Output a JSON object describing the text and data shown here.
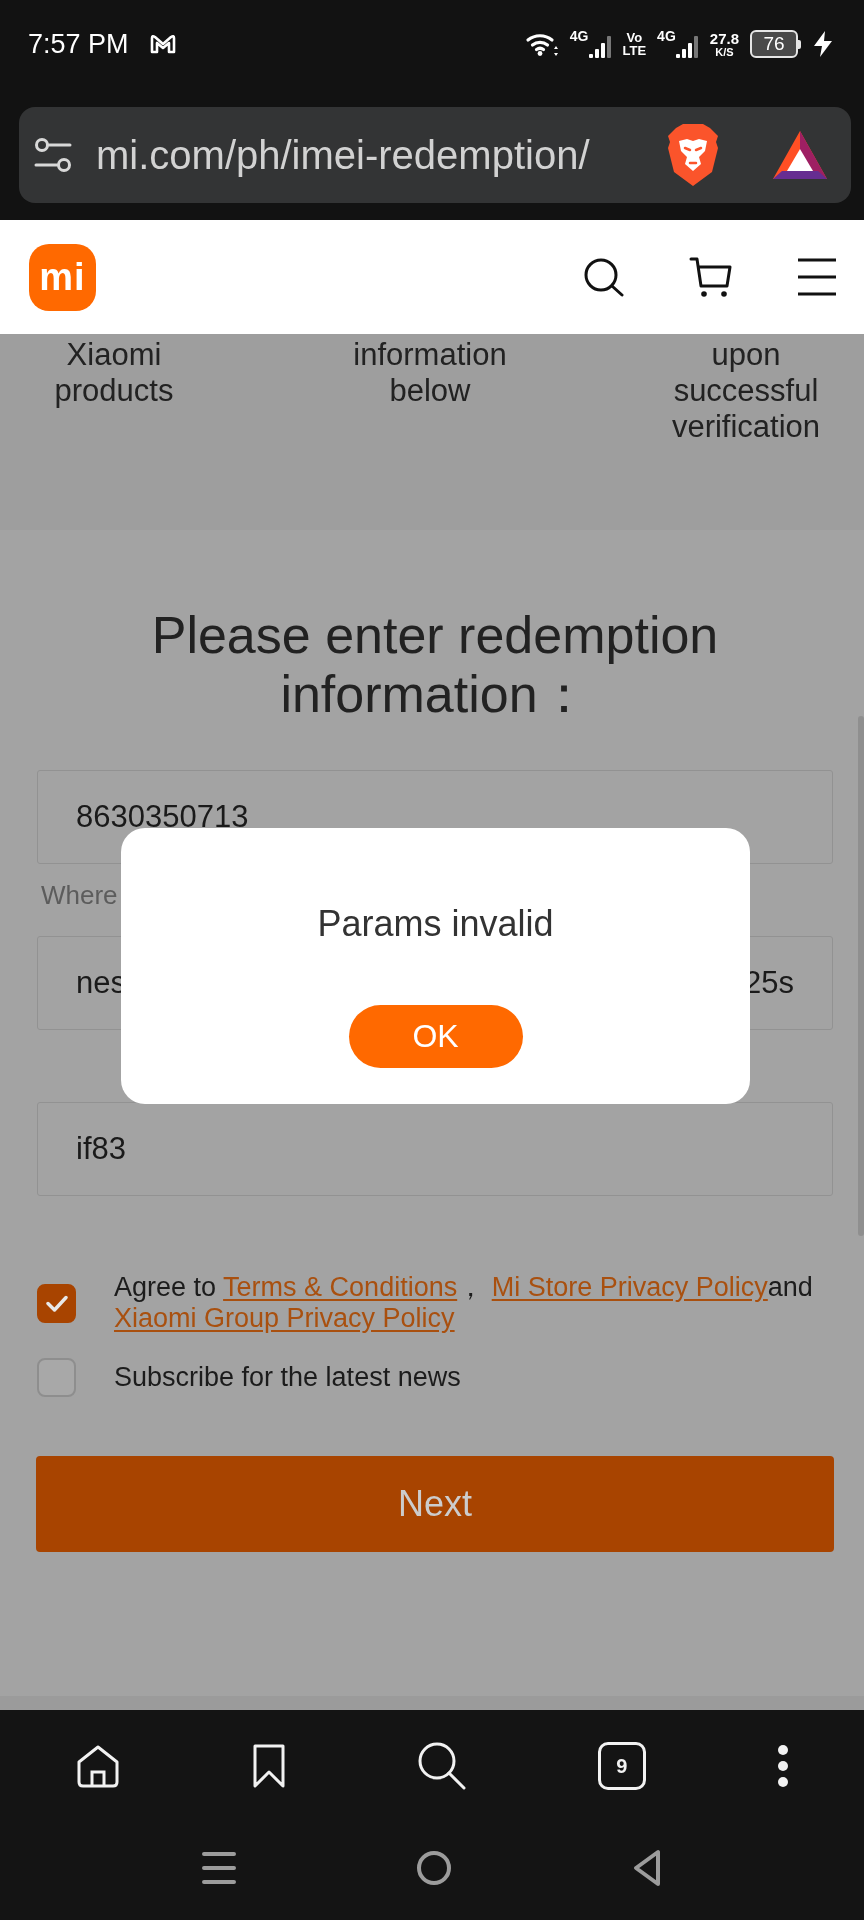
{
  "status_bar": {
    "time": "7:57 PM",
    "network_1": "4G",
    "volte": [
      "Vo",
      "LTE"
    ],
    "network_2": "4G",
    "speed": "27.8",
    "speed_unit": "K/S",
    "battery": "76"
  },
  "address_bar": {
    "url": "mi.com/ph/imei-redemption/"
  },
  "site_header": {
    "logo": "mi"
  },
  "steps": [
    "Xiaomi products",
    "information below",
    "upon successful verification"
  ],
  "form": {
    "heading": "Please enter redemption information：",
    "fields": [
      {
        "kind": "text",
        "value": "8630350713",
        "help": "Where"
      },
      {
        "kind": "split",
        "value_start": "nes",
        "value_end": "25s"
      },
      {
        "kind": "text",
        "value": "if83"
      }
    ],
    "checkboxes": [
      {
        "checked": true,
        "parts": [
          {
            "kind": "text",
            "text": "Agree to "
          },
          {
            "kind": "link",
            "text": "Terms & Conditions"
          },
          {
            "kind": "text",
            "text": "， "
          },
          {
            "kind": "link",
            "text": "Mi Store Privacy Policy"
          },
          {
            "kind": "text",
            "text": "and "
          },
          {
            "kind": "link",
            "text": "Xiaomi Group Privacy Policy"
          }
        ]
      },
      {
        "checked": false,
        "parts": [
          {
            "kind": "text",
            "text": "Subscribe for the latest news"
          }
        ]
      }
    ],
    "next_button": "Next"
  },
  "dialog": {
    "message": "Params invalid",
    "button": "OK"
  },
  "browser_toolbar": {
    "tab_count": "9"
  }
}
